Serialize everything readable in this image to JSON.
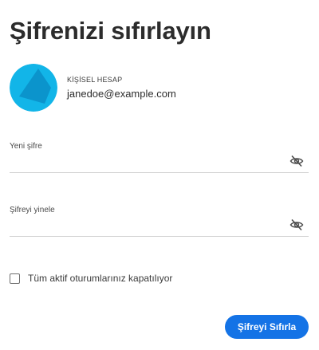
{
  "page": {
    "title": "Şifrenizi sıfırlayın"
  },
  "account": {
    "type_label": "KİŞİSEL HESAP",
    "email": "janedoe@example.com",
    "avatar_colors": {
      "background": "#12b5e8",
      "shape": "#0b94cc"
    }
  },
  "fields": [
    {
      "label": "Yeni şifre",
      "value": "",
      "toggle_icon": "eye-slash-icon"
    },
    {
      "label": "Şifreyi yinele",
      "value": "",
      "toggle_icon": "eye-slash-icon"
    }
  ],
  "sessions_checkbox": {
    "label": "Tüm aktif oturumlarınız kapatılıyor",
    "checked": false
  },
  "submit": {
    "label": "Şifreyi Sıfırla",
    "color": "#1473e6"
  }
}
